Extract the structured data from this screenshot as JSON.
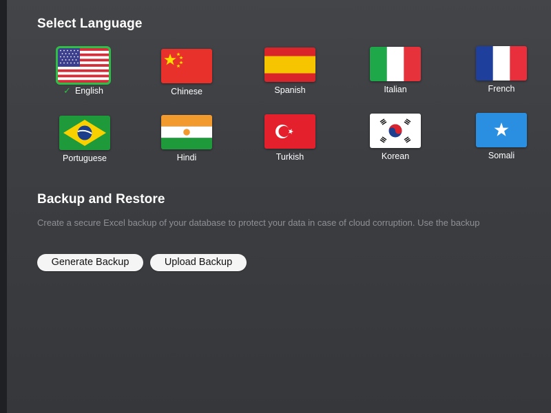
{
  "language_section": {
    "title": "Select Language",
    "selected": "English",
    "languages": [
      {
        "label": "English",
        "flag": "us-flag-icon"
      },
      {
        "label": "Chinese",
        "flag": "china-flag-icon"
      },
      {
        "label": "Spanish",
        "flag": "spain-flag-icon"
      },
      {
        "label": "Italian",
        "flag": "italy-flag-icon"
      },
      {
        "label": "French",
        "flag": "france-flag-icon"
      },
      {
        "label": "Portuguese",
        "flag": "brazil-flag-icon"
      },
      {
        "label": "Hindi",
        "flag": "india-flag-icon"
      },
      {
        "label": "Turkish",
        "flag": "turkey-flag-icon"
      },
      {
        "label": "Korean",
        "flag": "korea-flag-icon"
      },
      {
        "label": "Somali",
        "flag": "somalia-flag-icon"
      }
    ]
  },
  "backup_section": {
    "title": "Backup and Restore",
    "description": "Create a secure Excel backup of your database to protect your data in case of cloud corruption. Use the backup",
    "generate_label": "Generate Backup",
    "upload_label": "Upload Backup"
  },
  "colors": {
    "accent_selected": "#2fbf46",
    "background": "#3f4145",
    "button_bg": "#f5f5f5"
  }
}
